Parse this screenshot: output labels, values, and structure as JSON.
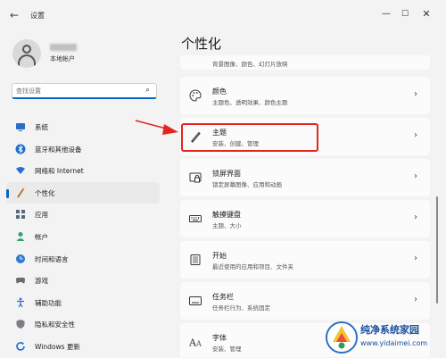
{
  "window": {
    "title": "设置",
    "back_icon": "←",
    "controls": [
      "minimize-icon",
      "maximize-icon",
      "close-icon"
    ]
  },
  "account": {
    "type": "本地帐户"
  },
  "search": {
    "placeholder": "查找设置",
    "icon": "search-icon"
  },
  "nav": {
    "items": [
      {
        "label": "系统",
        "icon": "system-icon",
        "active": false
      },
      {
        "label": "蓝牙和其他设备",
        "icon": "bluetooth-icon",
        "active": false
      },
      {
        "label": "网络和 Internet",
        "icon": "network-icon",
        "active": false
      },
      {
        "label": "个性化",
        "icon": "personalization-icon",
        "active": true
      },
      {
        "label": "应用",
        "icon": "apps-icon",
        "active": false
      },
      {
        "label": "帐户",
        "icon": "accounts-icon",
        "active": false
      },
      {
        "label": "时间和语言",
        "icon": "time-language-icon",
        "active": false
      },
      {
        "label": "游戏",
        "icon": "gaming-icon",
        "active": false
      },
      {
        "label": "辅助功能",
        "icon": "accessibility-icon",
        "active": false
      },
      {
        "label": "隐私和安全性",
        "icon": "privacy-icon",
        "active": false
      },
      {
        "label": "Windows 更新",
        "icon": "windows-update-icon",
        "active": false
      }
    ]
  },
  "main": {
    "title": "个性化",
    "cards": [
      {
        "title": "",
        "subtitle": "背景图像、颜色、幻灯片放映",
        "icon": "background-icon"
      },
      {
        "title": "颜色",
        "subtitle": "主题色、透明效果、颜色主题",
        "icon": "color-palette-icon"
      },
      {
        "title": "主题",
        "subtitle": "安装、创建、管理",
        "icon": "brush-icon"
      },
      {
        "title": "锁屏界面",
        "subtitle": "锁定屏幕图像、应用和动画",
        "icon": "lock-screen-icon"
      },
      {
        "title": "触摸键盘",
        "subtitle": "主题、大小",
        "icon": "keyboard-icon"
      },
      {
        "title": "开始",
        "subtitle": "最近使用的应用和项目、文件夹",
        "icon": "start-icon"
      },
      {
        "title": "任务栏",
        "subtitle": "任务栏行为、系统固定",
        "icon": "taskbar-icon"
      },
      {
        "title": "字体",
        "subtitle": "安装、管理",
        "icon": "fonts-icon"
      }
    ]
  },
  "watermark": {
    "text": "纯净系统家园",
    "url": "www.yidaimei.com"
  },
  "colors": {
    "accent": "#0067c0",
    "annotation": "#e52420"
  }
}
